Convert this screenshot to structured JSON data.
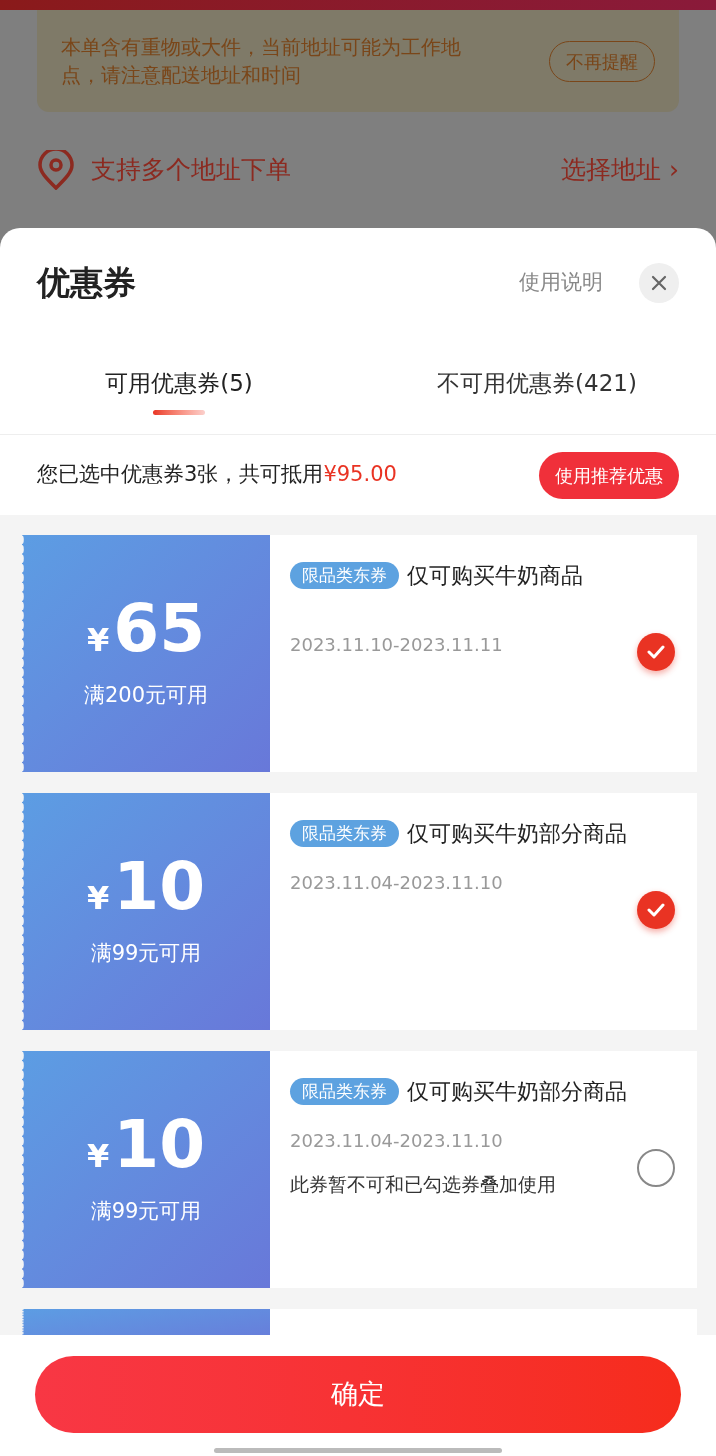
{
  "background": {
    "notice": {
      "text": "本单含有重物或大件，当前地址可能为工作地点，请注意配送地址和时间",
      "button": "不再提醒"
    },
    "address": {
      "text": "支持多个地址下单",
      "link": "选择地址",
      "chevron": "›"
    }
  },
  "sheet": {
    "title": "优惠券",
    "help_link": "使用说明",
    "tabs": [
      {
        "label": "可用优惠券(5)",
        "selected": true
      },
      {
        "label": "不可用优惠券(421)",
        "selected": false
      }
    ],
    "summary": {
      "text": "您已选中优惠券3张，共可抵用",
      "amount": "¥95.00",
      "button": "使用推荐优惠"
    },
    "coupons": [
      {
        "currency": "¥",
        "amount": "65",
        "condition": "满200元可用",
        "tag": "限品类东券",
        "title": "仅可购买牛奶商品",
        "validity": "2023.11.10-2023.11.11",
        "checked": true
      },
      {
        "currency": "¥",
        "amount": "10",
        "condition": "满99元可用",
        "tag": "限品类东券",
        "title": "仅可购买牛奶部分商品",
        "validity": "2023.11.04-2023.11.10",
        "checked": true
      },
      {
        "currency": "¥",
        "amount": "10",
        "condition": "满99元可用",
        "tag": "限品类东券",
        "title": "仅可购买牛奶部分商品",
        "validity": "2023.11.04-2023.11.10",
        "note": "此券暂不可和已勾选券叠加使用",
        "checked": false
      }
    ],
    "confirm_button": "确定"
  }
}
